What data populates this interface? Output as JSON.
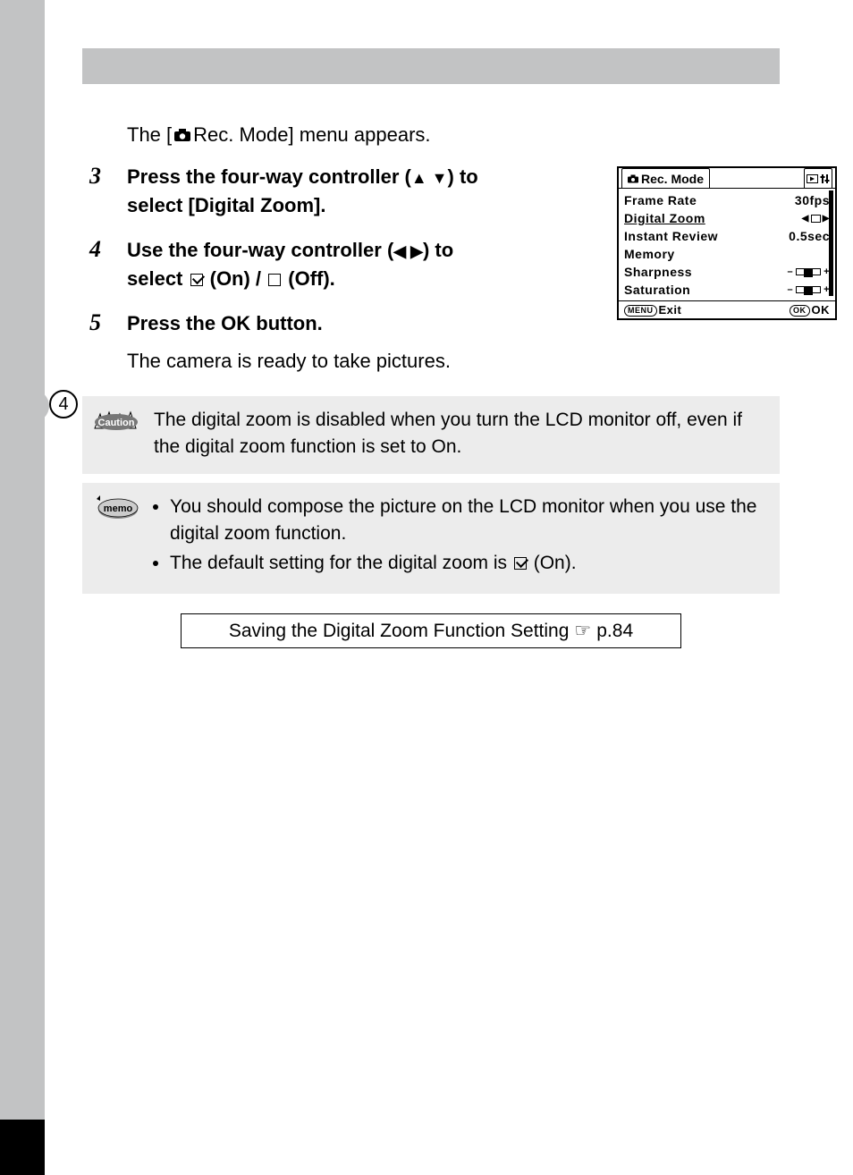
{
  "side_chapter_number": "4",
  "intro": {
    "prefix": "The [",
    "suffix": " Rec. Mode] menu appears."
  },
  "step3": {
    "num": "3",
    "part1": "Press the four-way controller (",
    "arrows1": "▲ ▼",
    "part2": ") to select [Digital Zoom]."
  },
  "step4": {
    "num": "4",
    "part1": "Use the four-way controller (",
    "arrows1": "◀ ▶",
    "part2": ") to select ",
    "onoff_on": "O (On) / ",
    "onoff_off": "P (Off)."
  },
  "step5": {
    "num": "5",
    "text": "Press the OK button.",
    "followup": "The camera is ready to take pictures."
  },
  "menu": {
    "title": "Rec. Mode",
    "rows": {
      "frame_rate": {
        "label": "Frame Rate",
        "value": "30fps"
      },
      "digital_zoom": {
        "label": "Digital Zoom"
      },
      "instant_review": {
        "label": "Instant Review",
        "value": "0.5sec"
      },
      "memory": {
        "label": "Memory"
      },
      "sharpness": {
        "label": "Sharpness"
      },
      "saturation": {
        "label": "Saturation"
      }
    },
    "footer": {
      "exit": "Exit",
      "ok": "OK",
      "menu_pill": "MENU",
      "ok_pill": "OK"
    }
  },
  "caution": {
    "label": "Caution",
    "text": "The digital zoom is disabled when you turn the LCD monitor off, even if the digital zoom function is set to On."
  },
  "memo": {
    "label": "memo",
    "item1": "You should compose the picture on the LCD monitor when you use the digital zoom function.",
    "item2_pre": "The default setting for the digital zoom is ",
    "item2_post": " (On)."
  },
  "ref": {
    "text": "Saving the Digital Zoom Function Setting",
    "page": "p.84"
  }
}
